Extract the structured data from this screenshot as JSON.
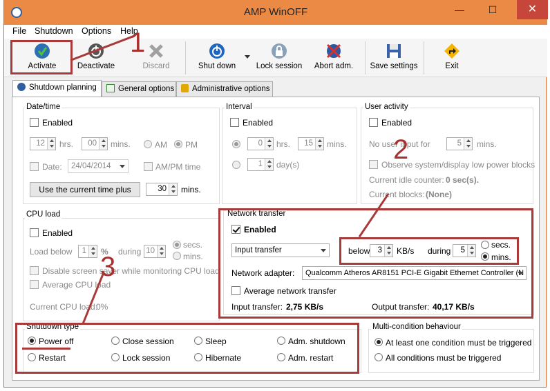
{
  "window": {
    "title": "AMP WinOFF",
    "minimize": "—",
    "maximize": "☐",
    "close": "✕"
  },
  "menu": [
    "File",
    "Shutdown",
    "Options",
    "Help"
  ],
  "toolbar": {
    "activate": "Activate",
    "deactivate": "Deactivate",
    "discard": "Discard",
    "shutdown": "Shut down",
    "lock": "Lock session",
    "abort": "Abort adm.",
    "save": "Save settings",
    "exit": "Exit"
  },
  "tabs": [
    "Shutdown planning",
    "General options",
    "Administrative options"
  ],
  "datetime": {
    "title": "Date/time",
    "enabled": "Enabled",
    "hrs_value": "12",
    "hrs": "hrs.",
    "mins_value": "00",
    "mins": "mins.",
    "am": "AM",
    "pm": "PM",
    "date": "Date:",
    "date_value": "24/04/2014",
    "ampm_time": "AM/PM time",
    "use_current": "Use the current time plus",
    "plus_value": "30",
    "plus_mins": "mins."
  },
  "interval": {
    "title": "Interval",
    "enabled": "Enabled",
    "hrs_value": "0",
    "hrs": "hrs.",
    "mins_value": "15",
    "mins": "mins.",
    "days_value": "1",
    "days": "day(s)"
  },
  "user_activity": {
    "title": "User activity",
    "enabled": "Enabled",
    "no_input": "No user input for",
    "no_input_value": "5",
    "mins": "mins.",
    "observe": "Observe system/display low power blocks",
    "idle_label": "Current idle counter:",
    "idle_value": "0 sec(s).",
    "blocks_label": "Current blocks:",
    "blocks_value": "(None)"
  },
  "cpu": {
    "title": "CPU load",
    "enabled": "Enabled",
    "load_below": "Load below",
    "load_value": "1",
    "pct": "%",
    "during": "during",
    "during_value": "10",
    "secs": "secs.",
    "mins": "mins.",
    "disable_saver": "Disable screen saver while monitoring CPU load",
    "average": "Average CPU load",
    "current_label": "Current CPU load:",
    "current_value": "0%"
  },
  "network": {
    "title": "Network transfer",
    "enabled": "Enabled",
    "mode": "Input transfer",
    "below": "below",
    "below_value": "3",
    "kbs": "KB/s",
    "during": "during",
    "during_value": "5",
    "secs": "secs.",
    "mins": "mins.",
    "adapter_label": "Network adapter:",
    "adapter_value": "Qualcomm Atheros AR8151 PCI-E Gigabit Ethernet Controller (N",
    "average": "Average network transfer",
    "input_label": "Input transfer:",
    "input_value": "2,75 KB/s",
    "output_label": "Output transfer:",
    "output_value": "40,17 KB/s"
  },
  "shutdown_type": {
    "title": "Shutdown type",
    "options": [
      "Power off",
      "Close session",
      "Sleep",
      "Adm. shutdown",
      "Restart",
      "Lock session",
      "Hibernate",
      "Adm. restart"
    ]
  },
  "multi": {
    "title": "Multi-condition behaviour",
    "at_least_one": "At least one condition must be triggered",
    "all": "All conditions must be triggered"
  },
  "annotations": [
    "1",
    "2",
    "3"
  ],
  "colors": {
    "titlebar": "#ea8a45",
    "annotation": "#a83a3a",
    "close": "#c7463a"
  }
}
